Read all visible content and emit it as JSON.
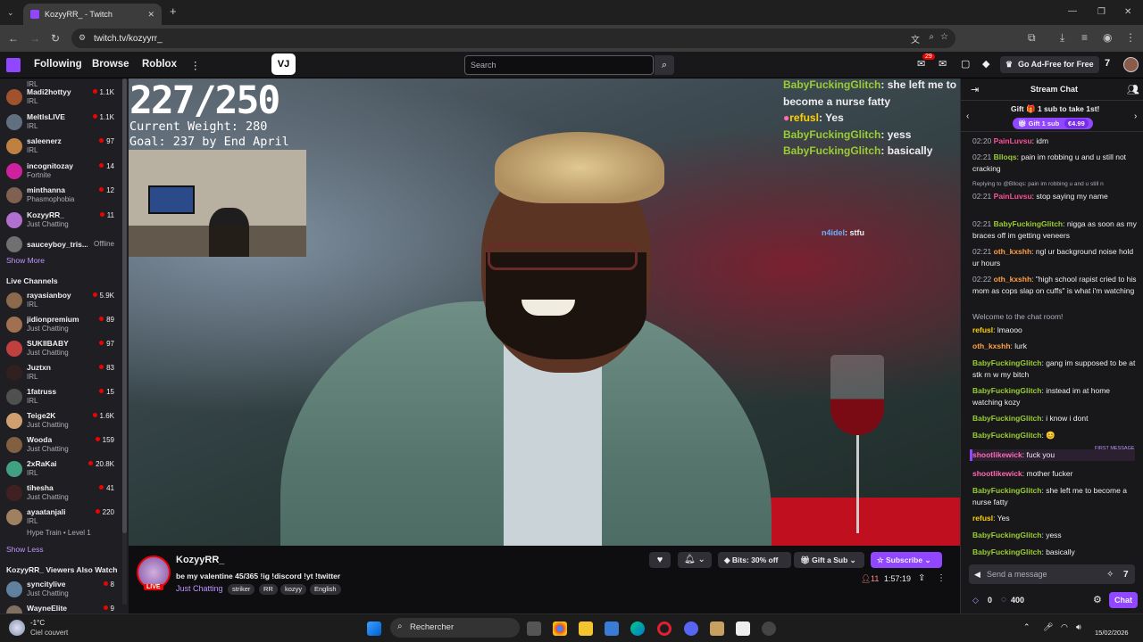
{
  "browser": {
    "tab_title": "KozyyRR_ - Twitch",
    "url": "twitch.tv/kozyyrr_",
    "tab_close": "✕",
    "new_tab": "+",
    "window_controls": [
      "—",
      "❐",
      "✕"
    ]
  },
  "nav": {
    "following": "Following",
    "browse": "Browse",
    "roblox": "Roblox",
    "more": "⋮",
    "search_placeholder": "Search",
    "notif_count": "29",
    "ad_free": "Go Ad-Free for Free"
  },
  "sidebar": {
    "followed": [
      {
        "name": "Madi2hottyy",
        "game": "IRL",
        "viewers": "1.1K",
        "color": "#a0522d"
      },
      {
        "name": "MeltlsLIVE",
        "game": "IRL",
        "viewers": "1.1K",
        "color": "#607080"
      },
      {
        "name": "saleenerz",
        "game": "IRL",
        "viewers": "97",
        "color": "#c08040"
      },
      {
        "name": "incognitozay",
        "game": "Fortnite",
        "viewers": "14",
        "color": "#d020a0"
      },
      {
        "name": "minthanna",
        "game": "Phasmophobia",
        "viewers": "12",
        "color": "#806050"
      },
      {
        "name": "KozyyRR_",
        "game": "Just Chatting",
        "viewers": "11",
        "color": "#b070d0"
      },
      {
        "name": "sauceyboy_tris...",
        "game": "",
        "viewers": "Offline",
        "color": "#707070"
      }
    ],
    "first_partial": {
      "game": "IRL"
    },
    "show_more": "Show More",
    "live_header": "Live Channels",
    "live": [
      {
        "name": "rayasianboy",
        "game": "IRL",
        "viewers": "5.9K",
        "color": "#8a6a4a"
      },
      {
        "name": "jidionpremium",
        "game": "Just Chatting",
        "viewers": "89",
        "color": "#a07050"
      },
      {
        "name": "SUKIIBABY",
        "game": "Just Chatting",
        "viewers": "97",
        "color": "#c04040"
      },
      {
        "name": "Juztxn",
        "game": "IRL",
        "viewers": "83",
        "color": "#302020"
      },
      {
        "name": "1fatruss",
        "game": "IRL",
        "viewers": "15",
        "color": "#505050"
      },
      {
        "name": "Teige2K",
        "game": "Just Chatting",
        "viewers": "1.6K",
        "color": "#d0a070"
      },
      {
        "name": "Wooda",
        "game": "Just Chatting",
        "viewers": "159",
        "color": "#806040"
      },
      {
        "name": "2xRaKai",
        "game": "IRL",
        "viewers": "20.8K",
        "color": "#40a080"
      },
      {
        "name": "tihesha",
        "game": "Just Chatting",
        "viewers": "41",
        "color": "#402020"
      },
      {
        "name": "ayaatanjali",
        "game": "IRL",
        "viewers": "220",
        "color": "#a08060"
      }
    ],
    "hype_train": "Hype Train • Level 1",
    "show_less": "Show Less",
    "also_watch_header": "KozyyRR_ Viewers Also Watch",
    "also_watch": [
      {
        "name": "syncitylive",
        "game": "Just Chatting",
        "viewers": "8",
        "color": "#6080a0"
      },
      {
        "name": "WayneElite",
        "game": "",
        "viewers": "9",
        "color": "#807060"
      }
    ]
  },
  "overlay": {
    "progress": "227/250",
    "weight": "Current Weight: 280",
    "goal": "Goal: 237 by End April",
    "chat": [
      {
        "user": "BabyFuckingGlitch",
        "msg": "she left me to become a nurse fatty"
      },
      {
        "user": "refusl",
        "msg": "Yes"
      },
      {
        "user": "BabyFuckingGlitch",
        "msg": "yess"
      },
      {
        "user": "BabyFuckingGlitch",
        "msg": "basically"
      }
    ],
    "float_chat": {
      "user": "n4idel",
      "msg": "stfu"
    }
  },
  "stream": {
    "streamer": "KozyyRR_",
    "title": "be my valentine 45/365 !ig !discord !yt !twitter",
    "category": "Just Chatting",
    "tags": [
      "striker",
      "RR",
      "kozyy",
      "English"
    ],
    "live": "LIVE",
    "viewers": "11",
    "uptime": "1:57:19",
    "bits": "Bits: 30% off",
    "gift": "Gift a Sub",
    "subscribe": "Subscribe"
  },
  "chat": {
    "header": "Stream Chat",
    "gift_banner": "Gift 🎁 1 sub to take 1st!",
    "gift_btn": "Gift 1 sub",
    "gift_price": "€4.99",
    "welcome": "Welcome to the chat room!",
    "first_message": "FIRST MESSAGE",
    "reply_note": "Replying to @Blloqs: pain im robbing u and u still n",
    "messages": [
      {
        "ts": "02:20",
        "user": "PainLuvsu",
        "msg": "idm"
      },
      {
        "ts": "02:21",
        "user": "Blloqs",
        "msg": "pain im robbing u and u still not cracking"
      },
      {
        "ts": "02:21",
        "user": "PainLuvsu",
        "msg": "stop saying my name"
      },
      {
        "ts": "02:21",
        "user": "BabyFuckingGlitch",
        "msg": "nigga as soon as my braces off im getting veneers"
      },
      {
        "ts": "02:21",
        "user": "oth_kxshh",
        "msg": "ngl ur background noise hold ur hours"
      },
      {
        "ts": "02:22",
        "user": "oth_kxshh",
        "msg": "\"high school rapist cried to his mom as cops slap on cuffs\" is what i'm watching"
      }
    ],
    "messages2": [
      {
        "user": "refusl",
        "msg": "lmaooo"
      },
      {
        "user": "oth_kxshh",
        "msg": "lurk"
      },
      {
        "user": "BabyFuckingGlitch",
        "msg": "gang im supposed to be at stk rn w my bitch"
      },
      {
        "user": "BabyFuckingGlitch",
        "msg": "instead im at home watching kozy"
      },
      {
        "user": "BabyFuckingGlitch",
        "msg": "i know i dont"
      },
      {
        "user": "BabyFuckingGlitch",
        "msg": "😊"
      },
      {
        "user": "shootlikewick",
        "msg": "fuck you"
      },
      {
        "user": "shootlikewick",
        "msg": "mother fucker"
      },
      {
        "user": "BabyFuckingGlitch",
        "msg": "she left me to become a nurse fatty"
      },
      {
        "user": "refusl",
        "msg": "Yes"
      },
      {
        "user": "BabyFuckingGlitch",
        "msg": "yess"
      },
      {
        "user": "BabyFuckingGlitch",
        "msg": "basically"
      }
    ],
    "input_placeholder": "Send a message",
    "bits": "0",
    "points": "400",
    "chat_btn": "Chat"
  },
  "taskbar": {
    "weather_temp": "-1°C",
    "weather_desc": "Ciel couvert",
    "search": "Rechercher",
    "date": "15/02/2026"
  }
}
